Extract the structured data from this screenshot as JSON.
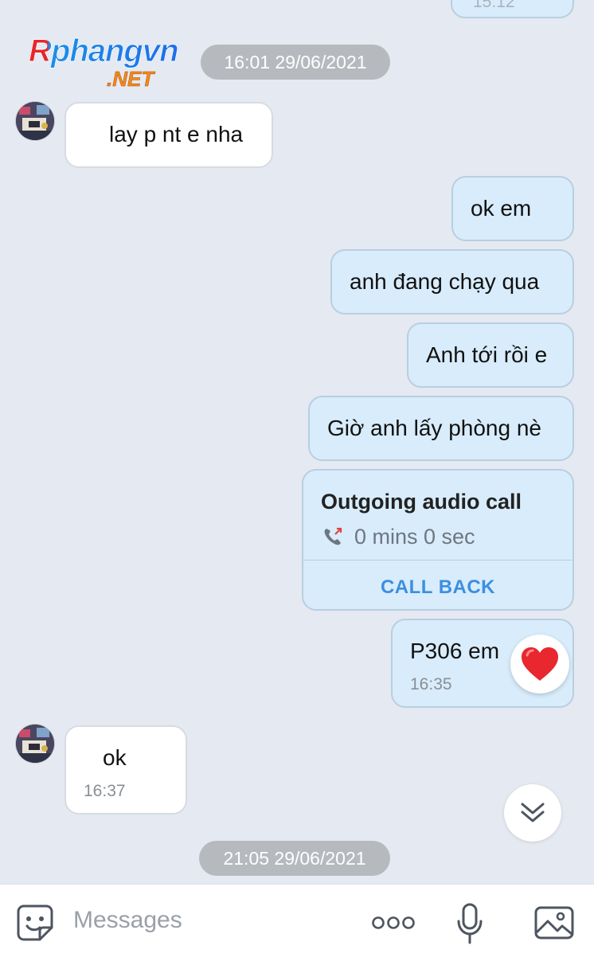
{
  "logo": {
    "top": "Rphangvn",
    "bottom": ".NET"
  },
  "top_partial_time": "15:12",
  "date_pills": [
    "16:01 29/06/2021",
    "21:05 29/06/2021"
  ],
  "messages": {
    "in1": {
      "text": "lay p nt e nha"
    },
    "out1": {
      "text": "ok em"
    },
    "out2": {
      "text": "anh đang chạy qua"
    },
    "out3": {
      "text": "Anh tới rồi e"
    },
    "out4": {
      "text": "Giờ anh lấy phòng nè"
    },
    "call": {
      "title": "Outgoing audio call",
      "duration": "0 mins 0 sec",
      "action": "CALL BACK"
    },
    "out5": {
      "text": "P306 em",
      "time": "16:35",
      "reaction": "❤️"
    },
    "in2": {
      "text": "ok",
      "time": "16:37"
    }
  },
  "input": {
    "placeholder": "Messages"
  },
  "icons": {
    "sticker": "sticker-icon",
    "more": "more-icon",
    "mic": "microphone-icon",
    "gallery": "image-icon",
    "scroll": "chevron-double-down-icon",
    "phone": "outgoing-call-icon"
  },
  "colors": {
    "background": "#e5e9f1",
    "outgoing_bubble": "#d8ecfb",
    "incoming_bubble": "#ffffff",
    "link": "#3b8fe0",
    "date_pill": "#b6babf"
  }
}
